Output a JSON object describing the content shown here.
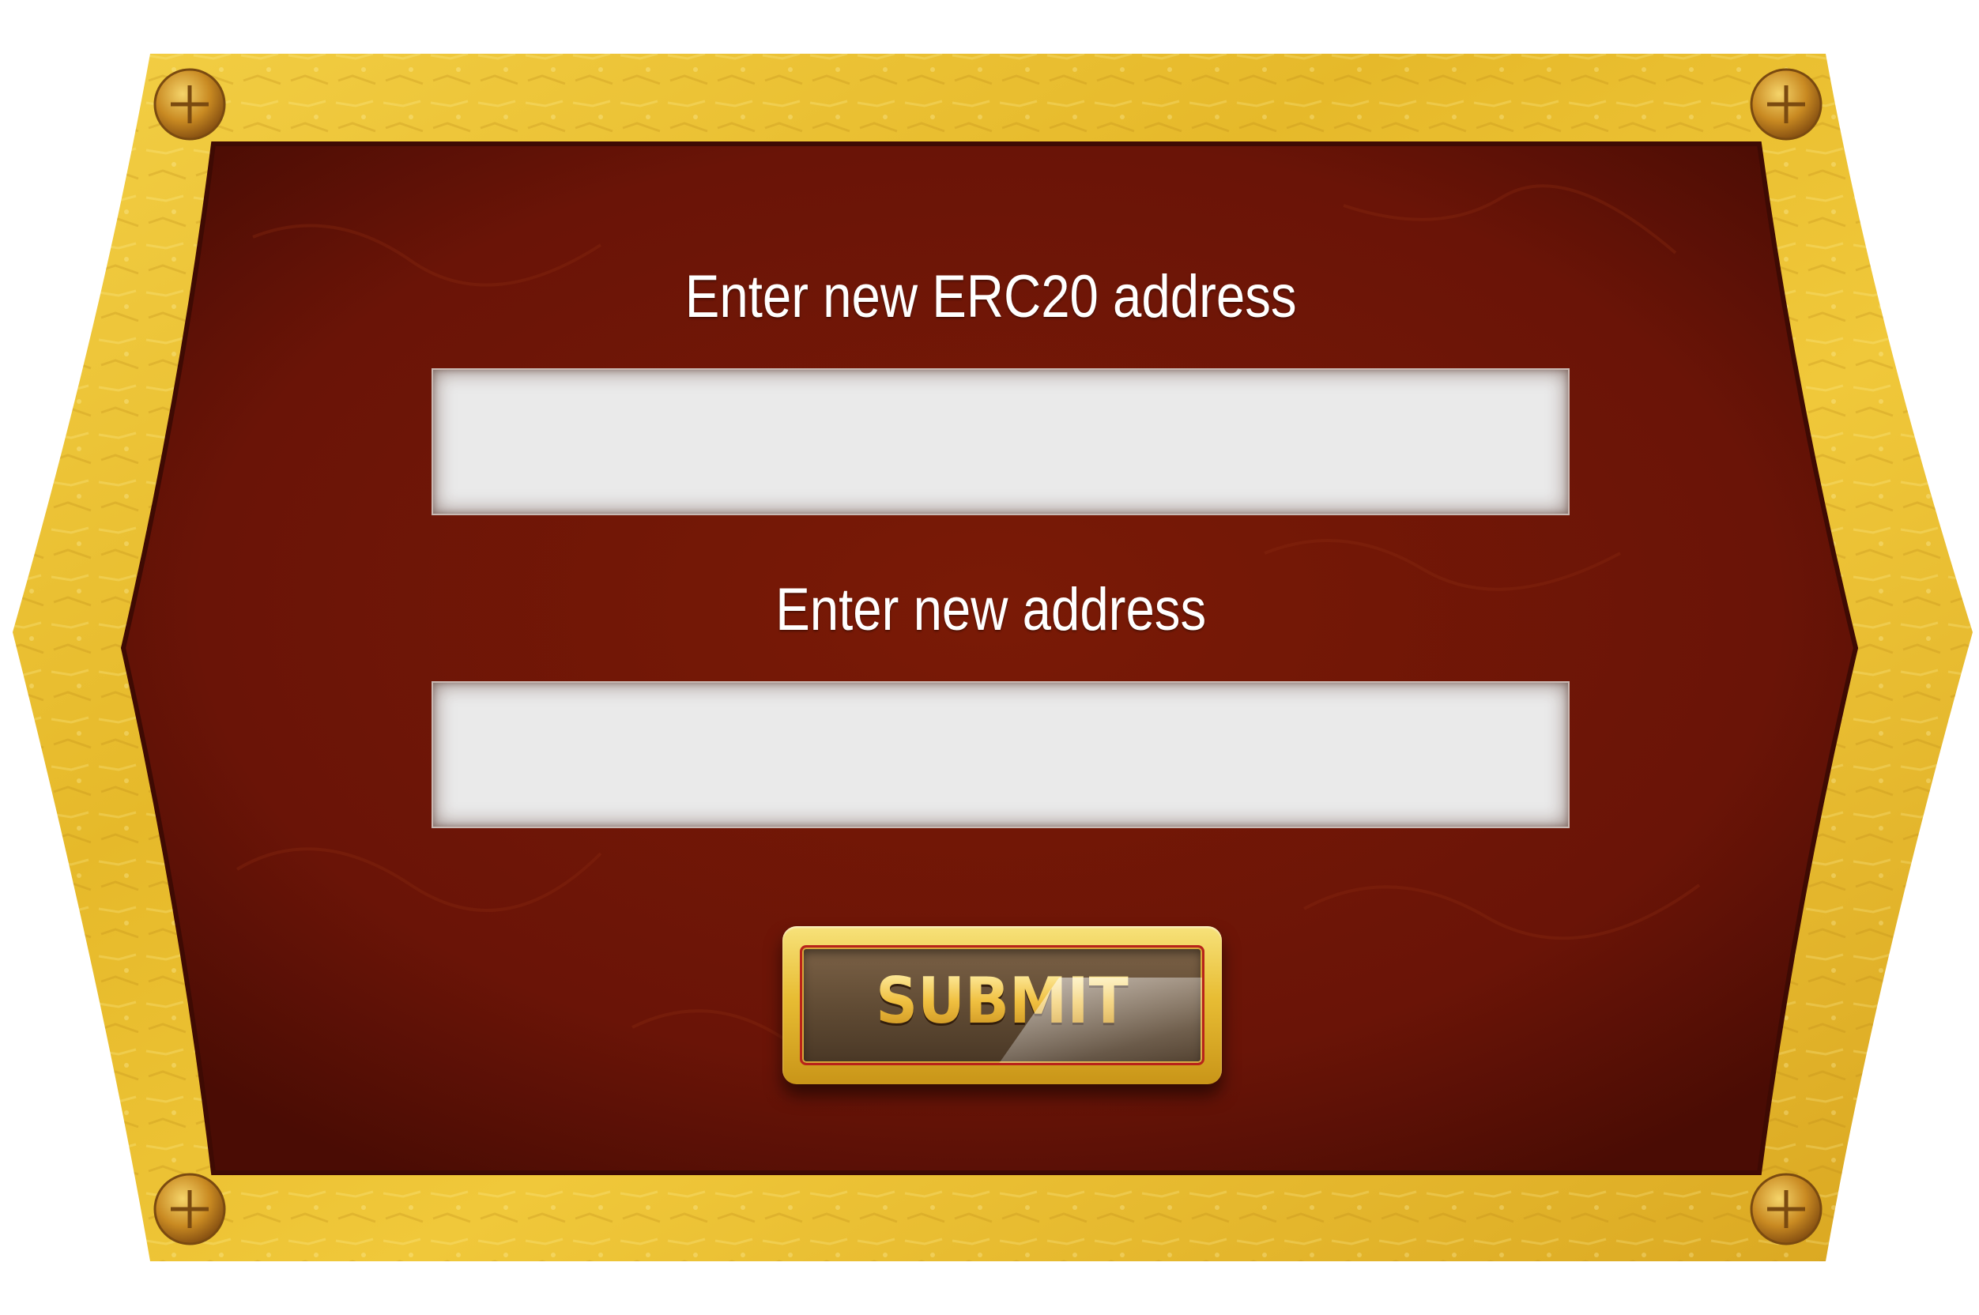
{
  "form": {
    "erc20_label": "Enter new ERC20 address",
    "erc20_value": "",
    "address_label": "Enter new address",
    "address_value": "",
    "submit_label": "SUBMIT"
  },
  "icons": {
    "corner_screws": [
      "screw-icon",
      "screw-icon",
      "screw-icon",
      "screw-icon"
    ]
  },
  "colors": {
    "frame_gold": "#e6bd2e",
    "panel_red": "#6a1407",
    "field_bg": "#eaeaea",
    "button_gold": "#e8bd34",
    "button_inner": "#5f4a33",
    "text": "#ffffff"
  }
}
